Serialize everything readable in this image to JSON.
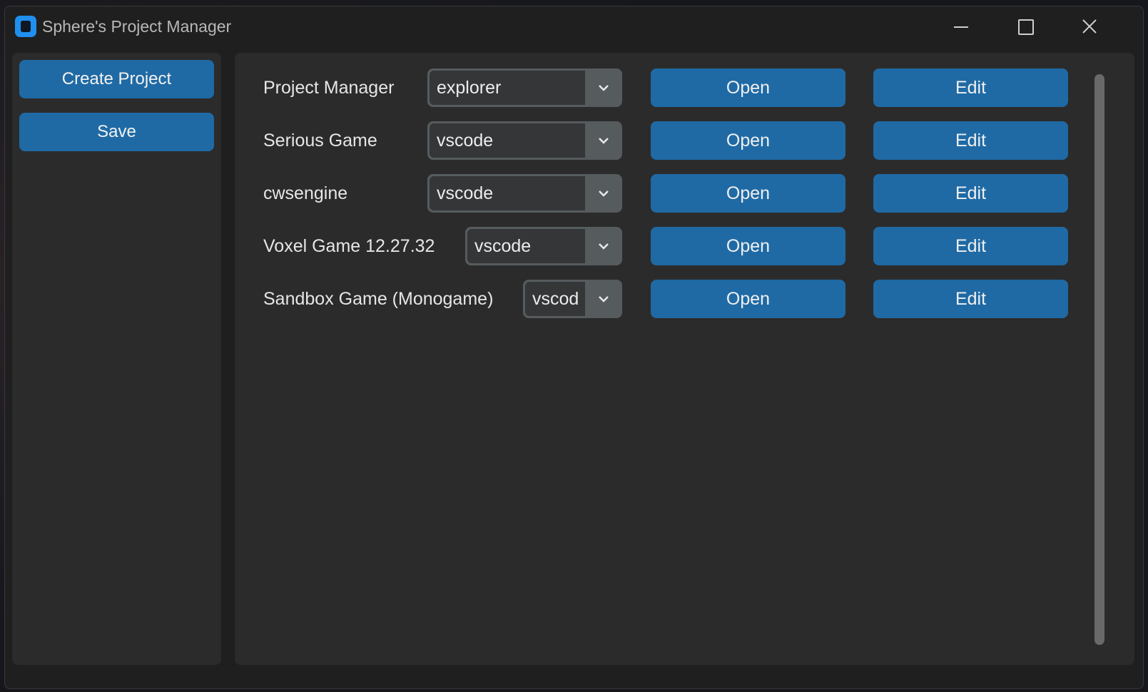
{
  "window": {
    "title": "Sphere's Project Manager",
    "icons": {
      "app": "app-icon",
      "minimize": "minimize-icon",
      "maximize": "maximize-icon",
      "close": "close-icon"
    }
  },
  "sidebar": {
    "create_label": "Create Project",
    "save_label": "Save"
  },
  "projects": [
    {
      "name": "Project Manager",
      "editor": "explorer",
      "open_label": "Open",
      "edit_label": "Edit"
    },
    {
      "name": "Serious Game",
      "editor": "vscode",
      "open_label": "Open",
      "edit_label": "Edit"
    },
    {
      "name": "cwsengine",
      "editor": "vscode",
      "open_label": "Open",
      "edit_label": "Edit"
    },
    {
      "name": "Voxel Game 12.27.32",
      "editor": "vscode",
      "open_label": "Open",
      "edit_label": "Edit"
    },
    {
      "name": "Sandbox Game (Monogame)",
      "editor": "vscod",
      "open_label": "Open",
      "edit_label": "Edit"
    }
  ],
  "colors": {
    "button": "#1f6aa5",
    "panel": "#2b2b2b",
    "window": "#1f1f1f",
    "dropdown_border": "#565b5e",
    "dropdown_fill": "#343638",
    "scrollbar": "#696969"
  }
}
